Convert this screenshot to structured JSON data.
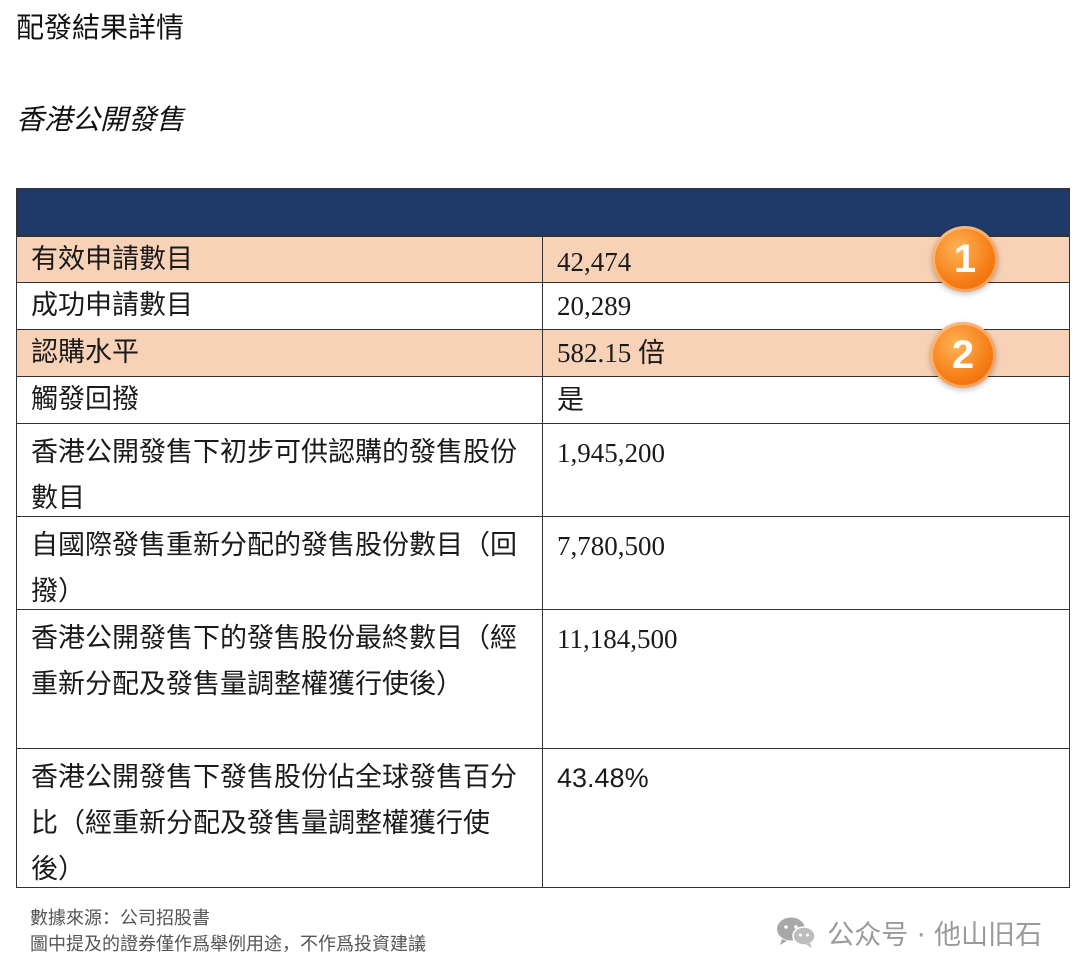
{
  "title": "配發結果詳情",
  "subtitle": "香港公開發售",
  "table": {
    "rows": [
      {
        "label": "有效申請數目",
        "value": "42,474"
      },
      {
        "label": "成功申請數目",
        "value": "20,289"
      },
      {
        "label": "認購水平",
        "value": "582.15 倍"
      },
      {
        "label": "觸發回撥",
        "value": "是"
      },
      {
        "label": "香港公開發售下初步可供認購的發售股份數目",
        "value": "1,945,200"
      },
      {
        "label": "自國際發售重新分配的發售股份數目（回撥）",
        "value": "7,780,500"
      },
      {
        "label": "香港公開發售下的發售股份最終數目（經重新分配及發售量調整權獲行使後）",
        "value": "11,184,500"
      },
      {
        "label": "香港公開發售下發售股份佔全球發售百分比（經重新分配及發售量調整權獲行使後）",
        "value": "43.48%"
      }
    ]
  },
  "badges": [
    "1",
    "2"
  ],
  "footnotes": {
    "source": "數據來源：公司招股書",
    "disclaimer": "圖中提及的證券僅作爲舉例用途，不作爲投資建議"
  },
  "watermark": {
    "icon": "wechat-icon",
    "text": "公众号 · 他山旧石"
  },
  "colors": {
    "header": "#1f3a68",
    "highlight": "#f7d2b7",
    "badge": "#f57a12"
  }
}
